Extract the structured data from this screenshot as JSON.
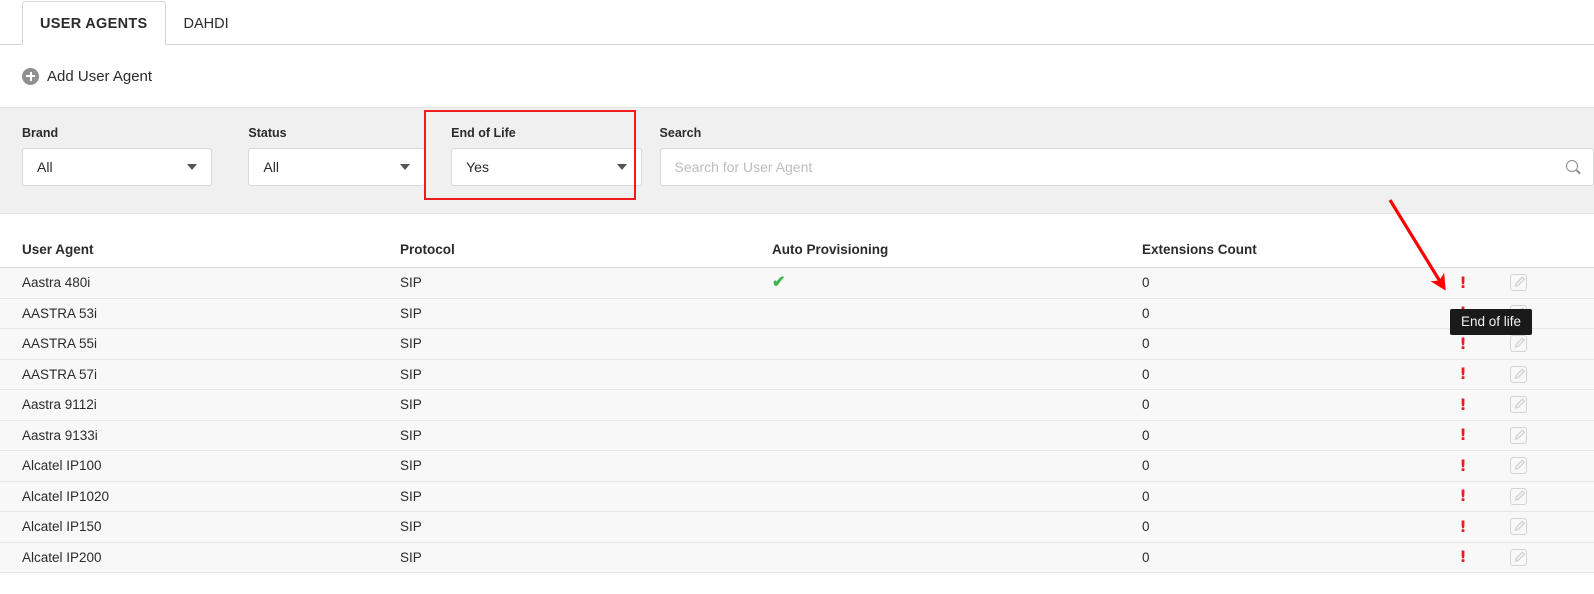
{
  "tabs": [
    {
      "label": "USER AGENTS",
      "active": true
    },
    {
      "label": "DAHDI",
      "active": false
    }
  ],
  "toolbar": {
    "add_label": "Add User Agent",
    "add_icon": "plus-circle-icon"
  },
  "filters": {
    "brand": {
      "label": "Brand",
      "value": "All"
    },
    "status": {
      "label": "Status",
      "value": "All"
    },
    "end_of_life": {
      "label": "End of Life",
      "value": "Yes",
      "highlighted": true
    },
    "search": {
      "label": "Search",
      "value": "",
      "placeholder": "Search for User Agent",
      "icon": "search-icon"
    }
  },
  "table": {
    "columns": [
      "User Agent",
      "Protocol",
      "Auto Provisioning",
      "Extensions Count"
    ],
    "rows": [
      {
        "user_agent": "Aastra 480i",
        "protocol": "SIP",
        "auto_provisioning": true,
        "extensions_count": "0",
        "end_of_life": true,
        "editable": true
      },
      {
        "user_agent": "AASTRA 53i",
        "protocol": "SIP",
        "auto_provisioning": false,
        "extensions_count": "0",
        "end_of_life": true,
        "editable": true
      },
      {
        "user_agent": "AASTRA 55i",
        "protocol": "SIP",
        "auto_provisioning": false,
        "extensions_count": "0",
        "end_of_life": true,
        "editable": true
      },
      {
        "user_agent": "AASTRA 57i",
        "protocol": "SIP",
        "auto_provisioning": false,
        "extensions_count": "0",
        "end_of_life": true,
        "editable": true
      },
      {
        "user_agent": "Aastra 9112i",
        "protocol": "SIP",
        "auto_provisioning": false,
        "extensions_count": "0",
        "end_of_life": true,
        "editable": true
      },
      {
        "user_agent": "Aastra 9133i",
        "protocol": "SIP",
        "auto_provisioning": false,
        "extensions_count": "0",
        "end_of_life": true,
        "editable": true
      },
      {
        "user_agent": "Alcatel IP100",
        "protocol": "SIP",
        "auto_provisioning": false,
        "extensions_count": "0",
        "end_of_life": true,
        "editable": true
      },
      {
        "user_agent": "Alcatel IP1020",
        "protocol": "SIP",
        "auto_provisioning": false,
        "extensions_count": "0",
        "end_of_life": true,
        "editable": true
      },
      {
        "user_agent": "Alcatel IP150",
        "protocol": "SIP",
        "auto_provisioning": false,
        "extensions_count": "0",
        "end_of_life": true,
        "editable": true
      },
      {
        "user_agent": "Alcatel IP200",
        "protocol": "SIP",
        "auto_provisioning": false,
        "extensions_count": "0",
        "end_of_life": true,
        "editable": true
      }
    ]
  },
  "tooltip": {
    "text": "End of life",
    "row_index": 1
  },
  "colors": {
    "accent_red": "#ee1c1c",
    "check_green": "#3cb54a",
    "filter_bar_bg": "#f0f0f0",
    "row_bg": "#f8f8f8",
    "tooltip_bg": "#1a1a1a"
  }
}
